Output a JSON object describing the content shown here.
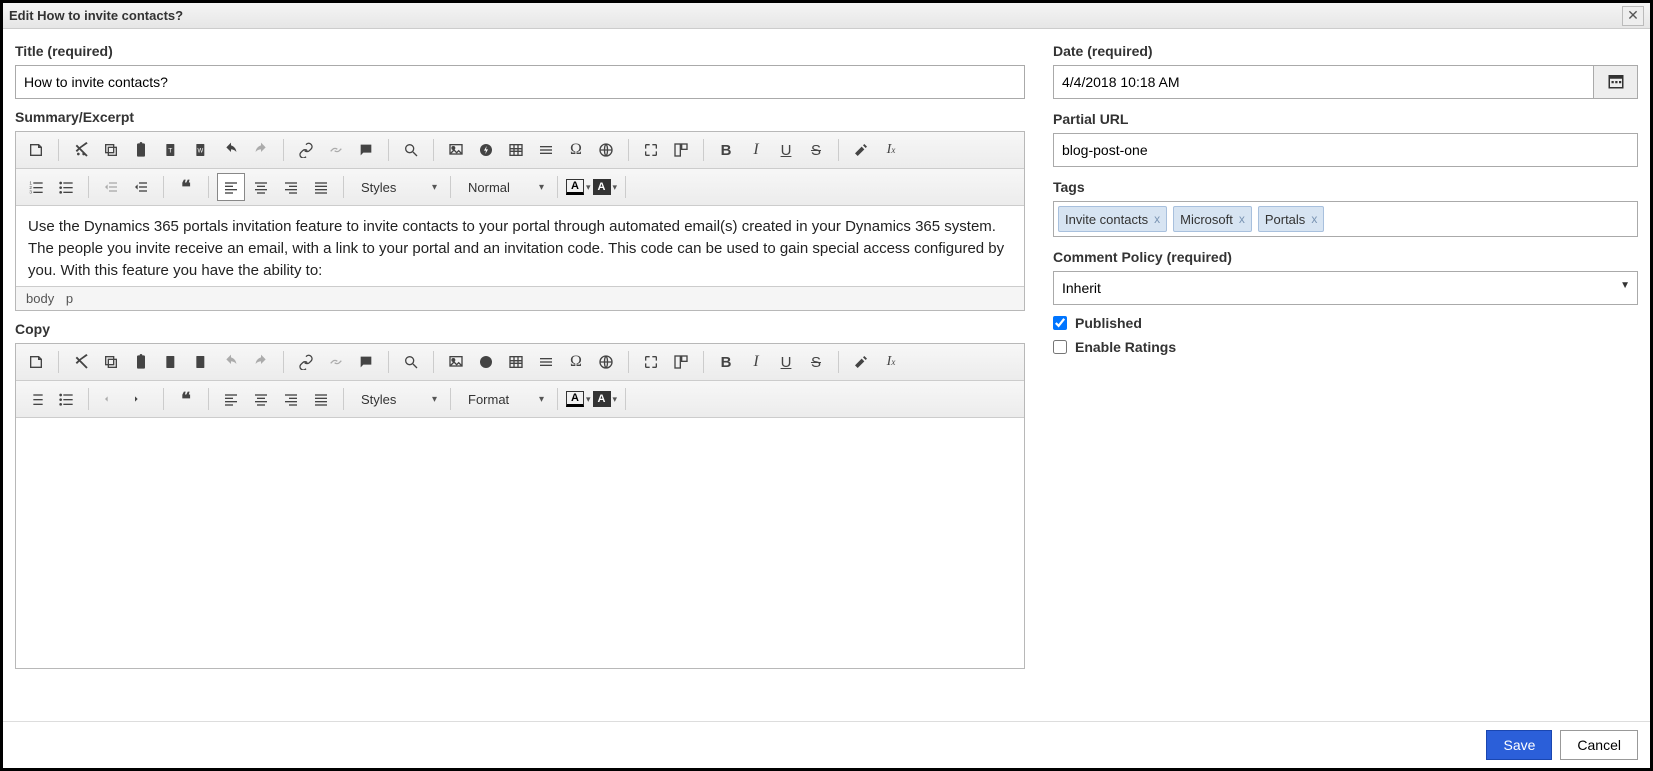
{
  "dialog": {
    "title": "Edit How to invite contacts?"
  },
  "left": {
    "title_label": "Title (required)",
    "title_value": "How to invite contacts?",
    "summary_label": "Summary/Excerpt",
    "copy_label": "Copy",
    "summary_text": "Use the Dynamics 365 portals invitation feature to invite contacts to your portal through automated email(s) created in your Dynamics 365 system. The people you invite receive an email, with a link to your portal and an invitation code. This code can be used to gain special access configured by you. With this feature you have the ability to:",
    "path_body": "body",
    "path_p": "p",
    "styles_label": "Styles",
    "normal_label": "Normal",
    "format_label": "Format"
  },
  "right": {
    "date_label": "Date (required)",
    "date_value": "4/4/2018 10:18 AM",
    "partial_url_label": "Partial URL",
    "partial_url_value": "blog-post-one",
    "tags_label": "Tags",
    "tags": [
      "Invite contacts",
      "Microsoft",
      "Portals"
    ],
    "comment_policy_label": "Comment Policy (required)",
    "comment_policy_value": "Inherit",
    "published_label": "Published",
    "published_checked": true,
    "ratings_label": "Enable Ratings",
    "ratings_checked": false
  },
  "footer": {
    "save": "Save",
    "cancel": "Cancel"
  }
}
